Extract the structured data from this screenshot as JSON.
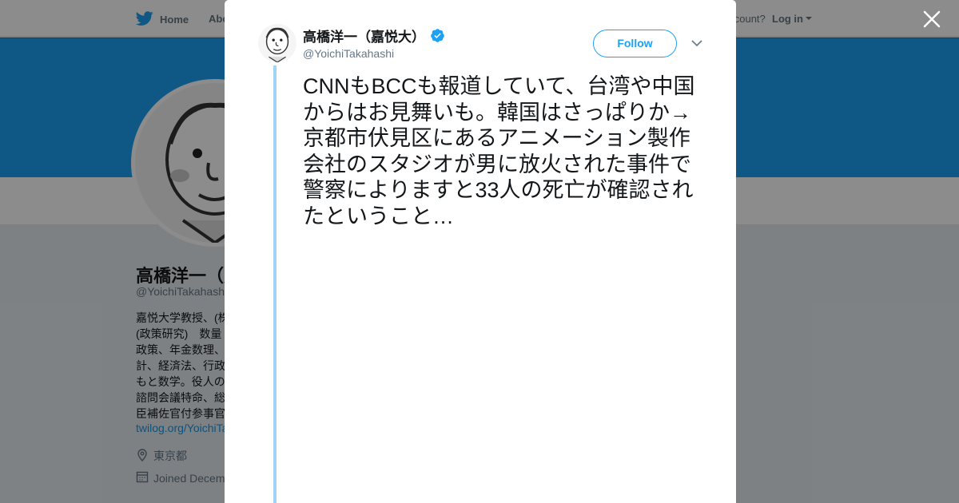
{
  "nav": {
    "home_label": "Home",
    "about_label": "Abo",
    "account_prompt": "account?",
    "login_label": "Log in",
    "home_icon": "twitter-bird-icon",
    "login_caret_icon": "caret-down-icon"
  },
  "profile": {
    "name": "高橋洋一（嘉",
    "handle": "@YoichiTakahash",
    "bio_lines": [
      "嘉悦大学教授、(株",
      "(政策研究)　数量",
      "政策、年金数理、",
      "計、経済法、行政",
      "もと数学。役人の",
      "諮問会議特命、総",
      "臣補佐官付参事官"
    ],
    "link": "twilog.org/YoichiTa",
    "location": "東京都",
    "joined": "Joined Decem",
    "location_icon": "location-pin-icon",
    "calendar_icon": "calendar-icon"
  },
  "colors": {
    "accent": "#1da1f2",
    "thread_line": "#9fd4f7",
    "text": "#14171a",
    "secondary_text": "#657786"
  },
  "modal": {
    "close_icon": "close-icon",
    "tweet": {
      "author_name": "高橋洋一（嘉悦大）",
      "verified_icon": "verified-badge-icon",
      "author_handle": "@YoichiTakahashi",
      "follow_label": "Follow",
      "more_icon": "chevron-down-icon",
      "text": "CNNもBCCも報道していて、台湾や中国からはお見舞いも。韓国はさっぱりか→京都市伏見区にあるアニメーション製作会社のスタジオが男に放火された事件で警察によりますと33人の死亡が確認されたということ…"
    }
  }
}
